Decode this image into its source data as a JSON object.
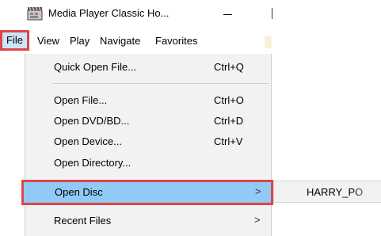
{
  "window": {
    "title": "Media Player Classic Ho...",
    "icon": "film-clapper-icon"
  },
  "menubar": {
    "items": [
      {
        "label": "File",
        "selected": true
      },
      {
        "label": "View"
      },
      {
        "label": "Play"
      },
      {
        "label": "Navigate"
      },
      {
        "label": "Favorites"
      }
    ]
  },
  "file_menu": {
    "items": [
      {
        "label": "Quick Open File...",
        "shortcut": "Ctrl+Q"
      },
      {
        "label": "Open File...",
        "shortcut": "Ctrl+O"
      },
      {
        "label": "Open DVD/BD...",
        "shortcut": "Ctrl+D"
      },
      {
        "label": "Open Device...",
        "shortcut": "Ctrl+V"
      },
      {
        "label": "Open Directory..."
      },
      {
        "label": "Open Disc",
        "submenu": true,
        "highlighted": true
      },
      {
        "label": "Recent Files",
        "submenu": true
      }
    ]
  },
  "submenu": {
    "items": [
      {
        "label": "HARRY_PO"
      }
    ]
  },
  "colors": {
    "highlight": "#91c9f7",
    "menu_selected": "#cce4f7",
    "annotation_border": "#e04646",
    "menu_bg": "#f2f2f2"
  }
}
